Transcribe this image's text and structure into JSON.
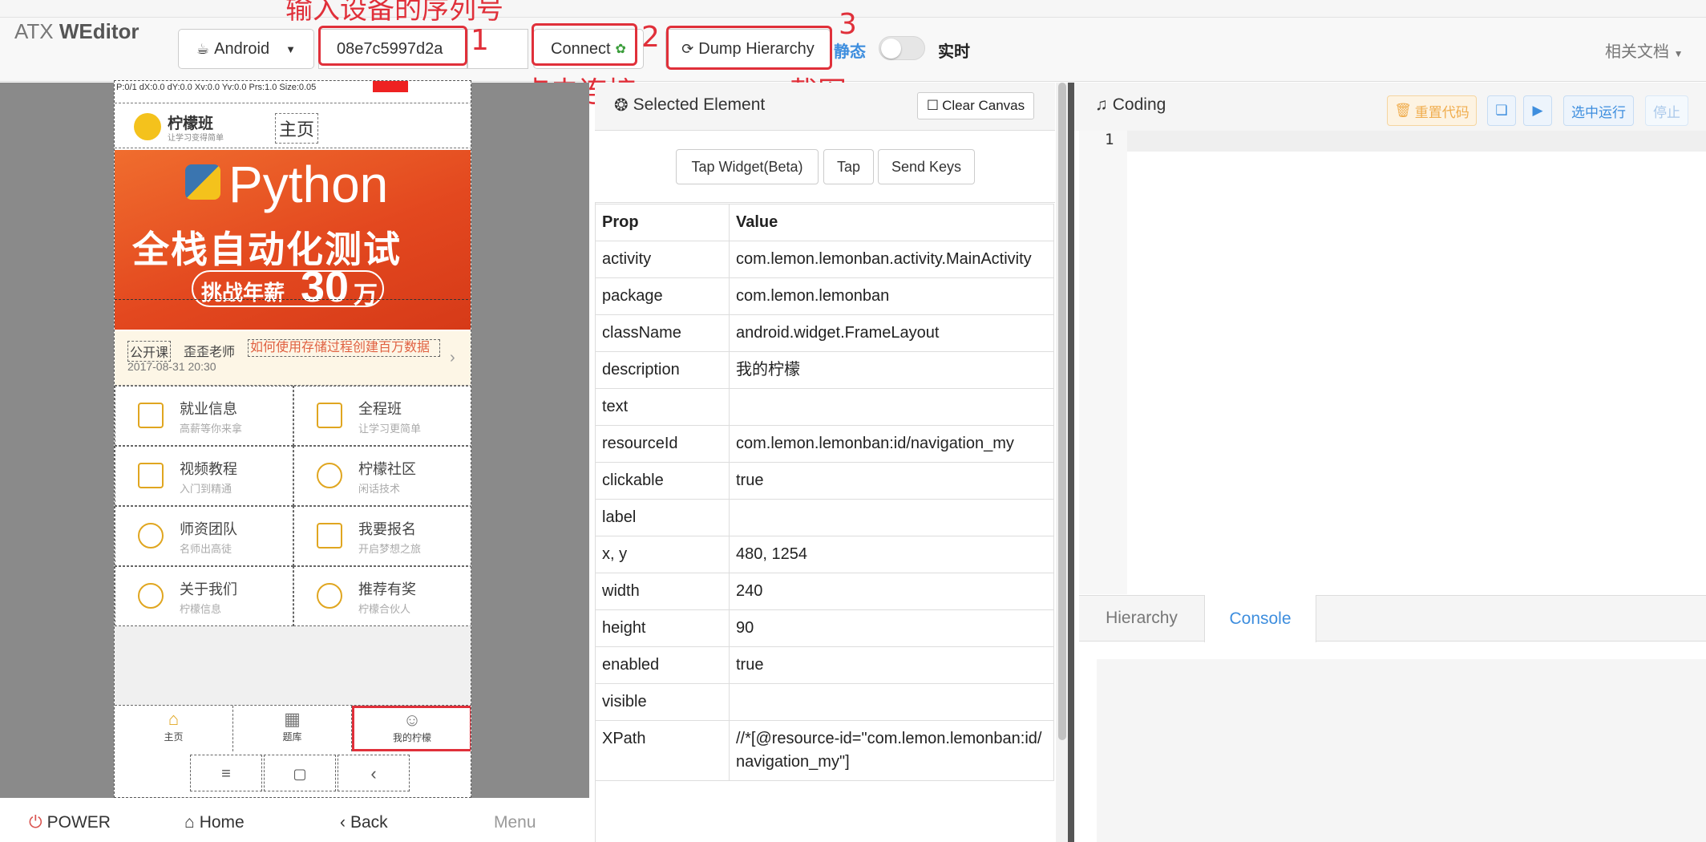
{
  "app": {
    "title_prefix": "ATX",
    "title_main": "WEditor"
  },
  "toolbar": {
    "platform": "Android",
    "serial_value": "08e7c5997d2a",
    "serial_extra_value": "",
    "connect_label": "Connect",
    "dump_label": "Dump Hierarchy",
    "mode_static": "静态",
    "mode_realtime": "实时",
    "docs_label": "相关文档"
  },
  "annotations": {
    "serial_hint": "输入设备的序列号",
    "step1": "1",
    "step2": "2",
    "step3": "3",
    "connect_hint": "点击连接",
    "dump_hint": "截图"
  },
  "device": {
    "status_text": "P:0/1  dX:0.0  dY:0.0  Xv:0.0  Yv:0.0  Prs:1.0  Size:0.05",
    "logo_name": "柠檬班",
    "logo_sub": "让学习变得简单",
    "home_title": "主页",
    "banner_title": "Python",
    "banner_subtitle": "全栈自动化测试",
    "banner_badge": "挑战年薪",
    "banner_badge_num": "30",
    "banner_badge_unit": "万",
    "notice_tag1": "公开课",
    "notice_tag2": "歪歪老师",
    "notice_time": "2017-08-31 20:30",
    "notice_text": "如何使用存储过程创建百万数据",
    "grid": [
      {
        "title": "就业信息",
        "sub": "高薪等你来拿"
      },
      {
        "title": "全程班",
        "sub": "让学习更简单"
      },
      {
        "title": "视频教程",
        "sub": "入门到精通"
      },
      {
        "title": "柠檬社区",
        "sub": "闲话技术"
      },
      {
        "title": "师资团队",
        "sub": "名师出高徒"
      },
      {
        "title": "我要报名",
        "sub": "开启梦想之旅"
      },
      {
        "title": "关于我们",
        "sub": "柠檬信息"
      },
      {
        "title": "推荐有奖",
        "sub": "柠檬合伙人"
      }
    ],
    "tabs": [
      "主页",
      "题库",
      "我的柠檬"
    ]
  },
  "device_controls": {
    "power": "POWER",
    "home": "Home",
    "back": "Back",
    "menu": "Menu"
  },
  "inspector": {
    "title": "Selected Element",
    "clear_canvas": "Clear Canvas",
    "tap_widget": "Tap Widget(Beta)",
    "tap": "Tap",
    "send_keys": "Send Keys",
    "col_prop": "Prop",
    "col_value": "Value",
    "rows": [
      {
        "prop": "activity",
        "value": "com.lemon.lemonban.activity.MainActivity"
      },
      {
        "prop": "package",
        "value": "com.lemon.lemonban"
      },
      {
        "prop": "className",
        "value": "android.widget.FrameLayout"
      },
      {
        "prop": "description",
        "value": "我的柠檬"
      },
      {
        "prop": "text",
        "value": ""
      },
      {
        "prop": "resourceId",
        "value": "com.lemon.lemonban:id/navigation_my"
      },
      {
        "prop": "clickable",
        "value": "true"
      },
      {
        "prop": "label",
        "value": ""
      },
      {
        "prop": "x, y",
        "value": "480, 1254"
      },
      {
        "prop": "width",
        "value": "240"
      },
      {
        "prop": "height",
        "value": "90"
      },
      {
        "prop": "enabled",
        "value": "true"
      },
      {
        "prop": "visible",
        "value": ""
      },
      {
        "prop": "XPath",
        "value": "//*[@resource-id=\"com.lemon.lemonban:id/navigation_my\"]"
      }
    ]
  },
  "coding": {
    "title": "Coding",
    "reset_code": "重置代码",
    "run_selected": "选中运行",
    "stop": "停止",
    "line_number": "1",
    "tab_hierarchy": "Hierarchy",
    "tab_console": "Console"
  },
  "colors": {
    "accent": "#3e8ede",
    "annotation": "#e0303a",
    "warning": "#f0ad4e",
    "banner": "#e3481f"
  }
}
